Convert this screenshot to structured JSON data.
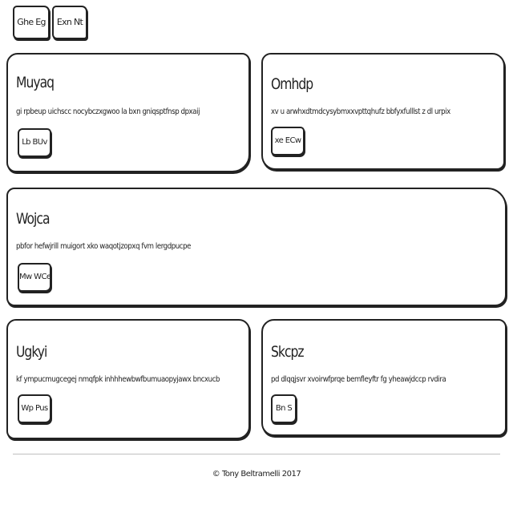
{
  "header": {
    "buttons": [
      {
        "label": "Ghe Eg"
      },
      {
        "label": "Exn Nt"
      }
    ]
  },
  "cards": [
    {
      "title": "Muyaq",
      "text": "gi rpbeup uichscc nocybczxgwoo la bxn gniqsptfnsp dpxaij",
      "button": "Lb BUv"
    },
    {
      "title": "Omhdp",
      "text": "xv u arwhxdtmdcysybmxxvpttqhufz bbfyxfulllst z dl urpix",
      "button": "xe ECw"
    },
    {
      "title": "Wojca",
      "text": "pbfor hefwjrill muigort xko waqotjzopxq fvm lergdpucpe",
      "button": "Mw WCe"
    },
    {
      "title": "Ugkyi",
      "text": "kf ympucmugcegej nmqfpk inhhhewbwfbumuaopyjawx bncxucb",
      "button": "Wp Pus"
    },
    {
      "title": "Skcpz",
      "text": "pd dlqqjsvr xvoirwfprqe bemfleyftr fg yheawjdccp rvdira",
      "button": "Bn S"
    }
  ],
  "footer": {
    "text": "© Tony Beltramelli 2017"
  }
}
